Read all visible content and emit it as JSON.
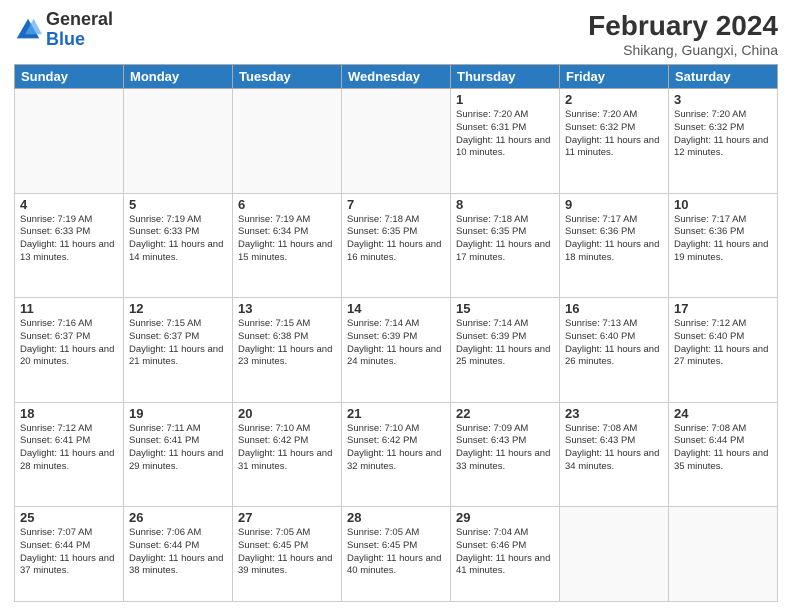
{
  "header": {
    "logo_general": "General",
    "logo_blue": "Blue",
    "month_year": "February 2024",
    "location": "Shikang, Guangxi, China"
  },
  "days_of_week": [
    "Sunday",
    "Monday",
    "Tuesday",
    "Wednesday",
    "Thursday",
    "Friday",
    "Saturday"
  ],
  "weeks": [
    [
      {
        "day": "",
        "info": ""
      },
      {
        "day": "",
        "info": ""
      },
      {
        "day": "",
        "info": ""
      },
      {
        "day": "",
        "info": ""
      },
      {
        "day": "1",
        "info": "Sunrise: 7:20 AM\nSunset: 6:31 PM\nDaylight: 11 hours\nand 10 minutes."
      },
      {
        "day": "2",
        "info": "Sunrise: 7:20 AM\nSunset: 6:32 PM\nDaylight: 11 hours\nand 11 minutes."
      },
      {
        "day": "3",
        "info": "Sunrise: 7:20 AM\nSunset: 6:32 PM\nDaylight: 11 hours\nand 12 minutes."
      }
    ],
    [
      {
        "day": "4",
        "info": "Sunrise: 7:19 AM\nSunset: 6:33 PM\nDaylight: 11 hours\nand 13 minutes."
      },
      {
        "day": "5",
        "info": "Sunrise: 7:19 AM\nSunset: 6:33 PM\nDaylight: 11 hours\nand 14 minutes."
      },
      {
        "day": "6",
        "info": "Sunrise: 7:19 AM\nSunset: 6:34 PM\nDaylight: 11 hours\nand 15 minutes."
      },
      {
        "day": "7",
        "info": "Sunrise: 7:18 AM\nSunset: 6:35 PM\nDaylight: 11 hours\nand 16 minutes."
      },
      {
        "day": "8",
        "info": "Sunrise: 7:18 AM\nSunset: 6:35 PM\nDaylight: 11 hours\nand 17 minutes."
      },
      {
        "day": "9",
        "info": "Sunrise: 7:17 AM\nSunset: 6:36 PM\nDaylight: 11 hours\nand 18 minutes."
      },
      {
        "day": "10",
        "info": "Sunrise: 7:17 AM\nSunset: 6:36 PM\nDaylight: 11 hours\nand 19 minutes."
      }
    ],
    [
      {
        "day": "11",
        "info": "Sunrise: 7:16 AM\nSunset: 6:37 PM\nDaylight: 11 hours\nand 20 minutes."
      },
      {
        "day": "12",
        "info": "Sunrise: 7:15 AM\nSunset: 6:37 PM\nDaylight: 11 hours\nand 21 minutes."
      },
      {
        "day": "13",
        "info": "Sunrise: 7:15 AM\nSunset: 6:38 PM\nDaylight: 11 hours\nand 23 minutes."
      },
      {
        "day": "14",
        "info": "Sunrise: 7:14 AM\nSunset: 6:39 PM\nDaylight: 11 hours\nand 24 minutes."
      },
      {
        "day": "15",
        "info": "Sunrise: 7:14 AM\nSunset: 6:39 PM\nDaylight: 11 hours\nand 25 minutes."
      },
      {
        "day": "16",
        "info": "Sunrise: 7:13 AM\nSunset: 6:40 PM\nDaylight: 11 hours\nand 26 minutes."
      },
      {
        "day": "17",
        "info": "Sunrise: 7:12 AM\nSunset: 6:40 PM\nDaylight: 11 hours\nand 27 minutes."
      }
    ],
    [
      {
        "day": "18",
        "info": "Sunrise: 7:12 AM\nSunset: 6:41 PM\nDaylight: 11 hours\nand 28 minutes."
      },
      {
        "day": "19",
        "info": "Sunrise: 7:11 AM\nSunset: 6:41 PM\nDaylight: 11 hours\nand 29 minutes."
      },
      {
        "day": "20",
        "info": "Sunrise: 7:10 AM\nSunset: 6:42 PM\nDaylight: 11 hours\nand 31 minutes."
      },
      {
        "day": "21",
        "info": "Sunrise: 7:10 AM\nSunset: 6:42 PM\nDaylight: 11 hours\nand 32 minutes."
      },
      {
        "day": "22",
        "info": "Sunrise: 7:09 AM\nSunset: 6:43 PM\nDaylight: 11 hours\nand 33 minutes."
      },
      {
        "day": "23",
        "info": "Sunrise: 7:08 AM\nSunset: 6:43 PM\nDaylight: 11 hours\nand 34 minutes."
      },
      {
        "day": "24",
        "info": "Sunrise: 7:08 AM\nSunset: 6:44 PM\nDaylight: 11 hours\nand 35 minutes."
      }
    ],
    [
      {
        "day": "25",
        "info": "Sunrise: 7:07 AM\nSunset: 6:44 PM\nDaylight: 11 hours\nand 37 minutes."
      },
      {
        "day": "26",
        "info": "Sunrise: 7:06 AM\nSunset: 6:44 PM\nDaylight: 11 hours\nand 38 minutes."
      },
      {
        "day": "27",
        "info": "Sunrise: 7:05 AM\nSunset: 6:45 PM\nDaylight: 11 hours\nand 39 minutes."
      },
      {
        "day": "28",
        "info": "Sunrise: 7:05 AM\nSunset: 6:45 PM\nDaylight: 11 hours\nand 40 minutes."
      },
      {
        "day": "29",
        "info": "Sunrise: 7:04 AM\nSunset: 6:46 PM\nDaylight: 11 hours\nand 41 minutes."
      },
      {
        "day": "",
        "info": ""
      },
      {
        "day": "",
        "info": ""
      }
    ]
  ]
}
